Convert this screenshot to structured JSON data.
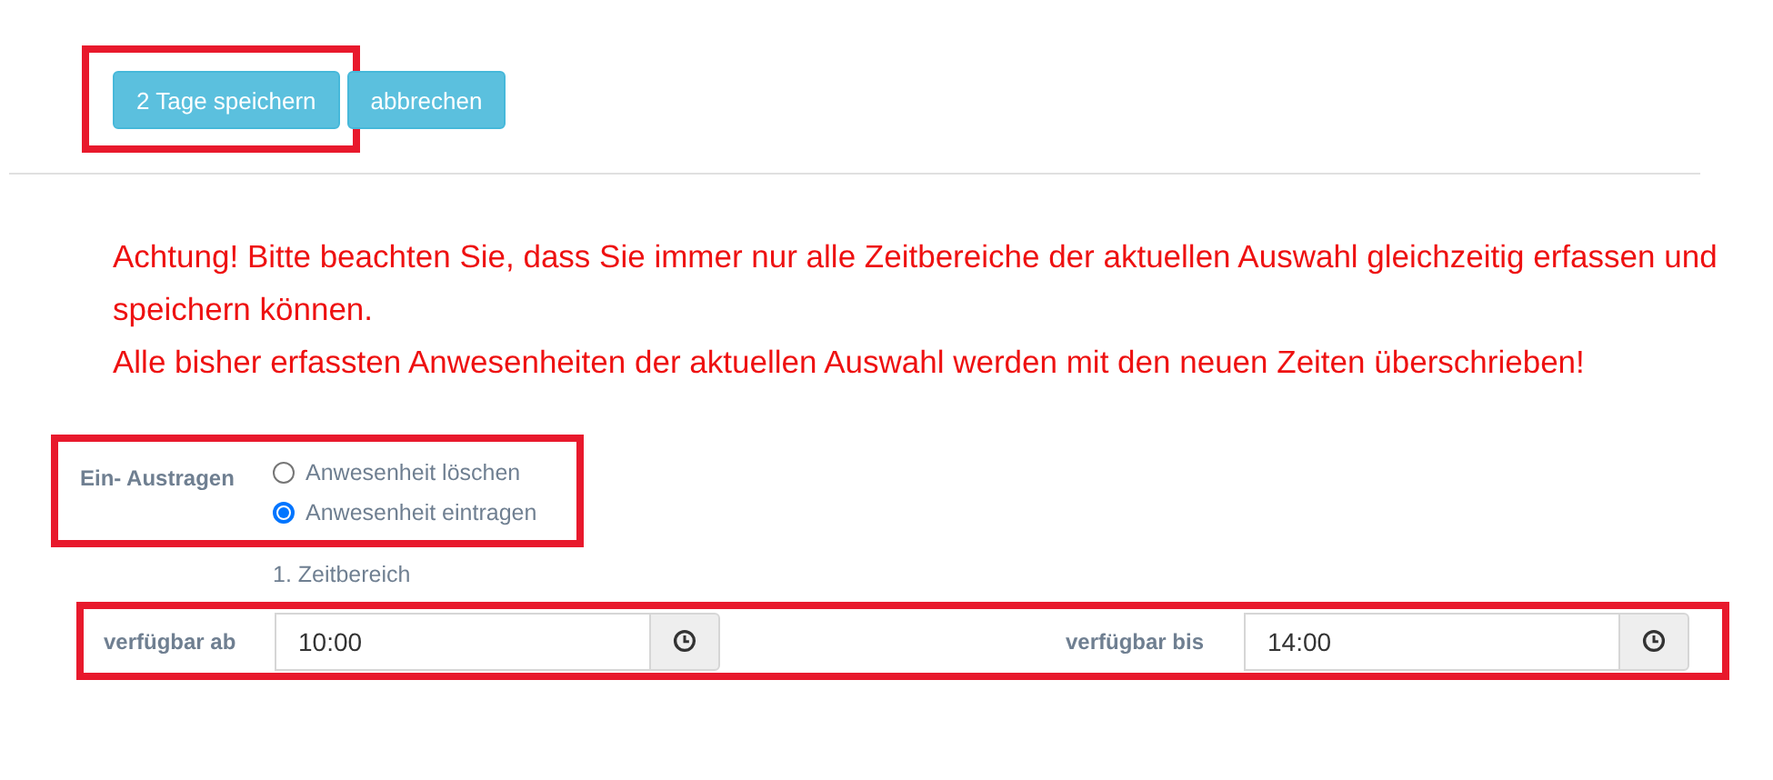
{
  "actions": {
    "highlighted": true,
    "buttons": [
      {
        "label": "2 Tage speichern"
      },
      {
        "label": "abbrechen"
      }
    ]
  },
  "warning": [
    "Achtung! Bitte beachten Sie, dass Sie immer nur alle Zeitbereiche der aktuellen Auswahl gleichzeitig erfassen und speichern können.",
    "Alle bisher erfassten Anwesenheiten der aktuellen Auswahl werden mit den neuen Zeiten überschrieben!"
  ],
  "mode": {
    "highlighted": true,
    "label": "Ein- Austragen",
    "options": [
      {
        "label": "Anwesenheit löschen",
        "selected": false
      },
      {
        "label": "Anwesenheit eintragen",
        "selected": true
      }
    ]
  },
  "range": {
    "title": "1. Zeitbereich",
    "highlighted": true,
    "from": {
      "label": "verfügbar ab",
      "value": "10:00"
    },
    "to": {
      "label": "verfügbar bis",
      "value": "14:00"
    }
  }
}
